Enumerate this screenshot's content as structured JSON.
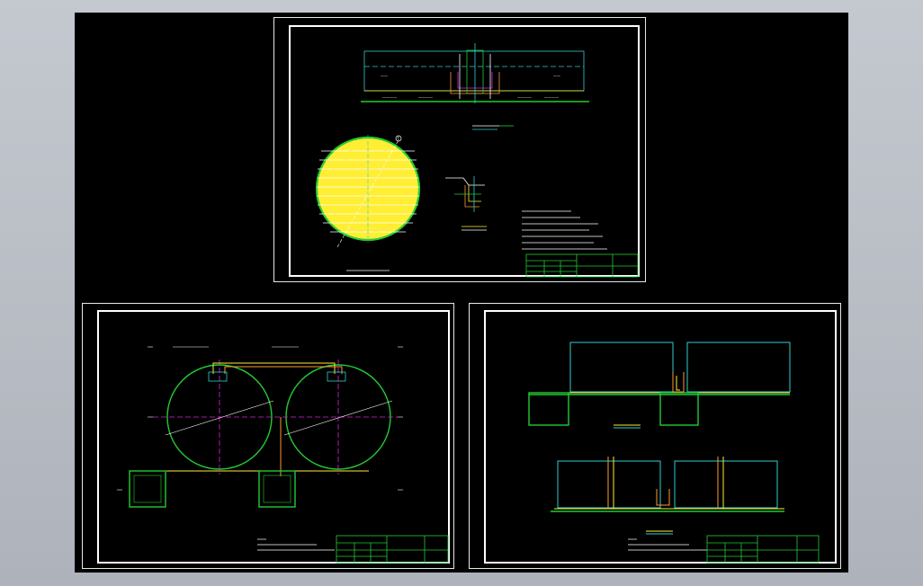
{
  "drawings": [
    {
      "id": "sheet-1",
      "description_visible": false,
      "labels": [
        "1"
      ]
    },
    {
      "id": "sheet-2",
      "labels": []
    },
    {
      "id": "sheet-3",
      "labels": []
    }
  ],
  "colors": {
    "background": "#000000",
    "viewport": "#b8bcc4",
    "frame": "#ffffff",
    "green": "#22cc33",
    "cyan": "#33cccc",
    "yellow": "#ffee33",
    "magenta": "#dd22dd",
    "orange": "#ff9933"
  },
  "icons": [
    "circle-marker-icon"
  ]
}
